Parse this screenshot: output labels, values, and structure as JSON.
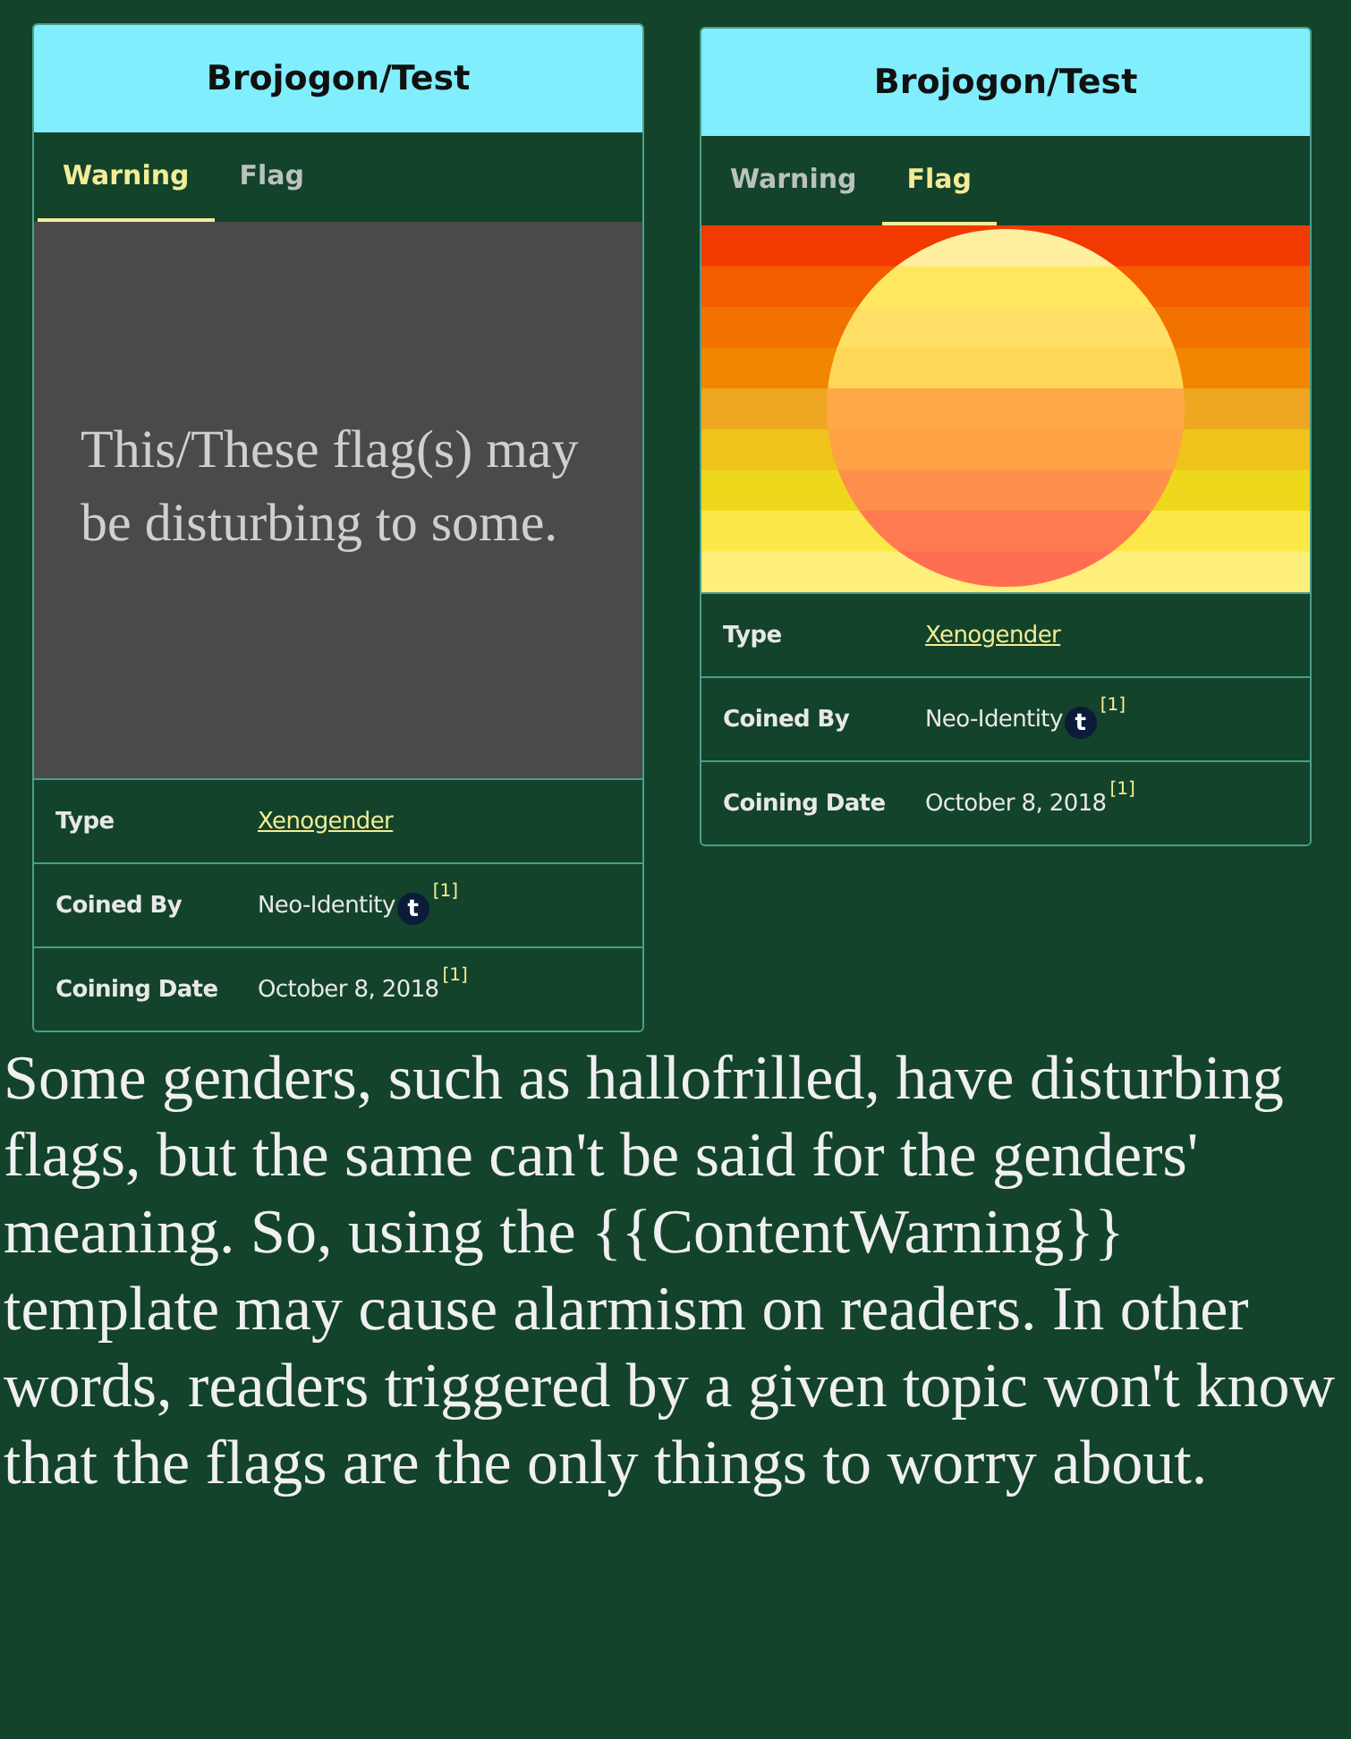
{
  "cards": [
    {
      "title": "Brojogon/Test",
      "tabs": [
        {
          "label": "Warning",
          "selected": true
        },
        {
          "label": "Flag",
          "selected": false
        }
      ],
      "panel": {
        "kind": "warning",
        "text": "This/These flag(s) may be disturbing to some."
      },
      "rows": [
        {
          "label": "Type",
          "value": "Xenogender",
          "kind": "link"
        },
        {
          "label": "Coined By",
          "value": "Neo-Identity",
          "kind": "text",
          "icon_letter": "t",
          "ref": "[1]"
        },
        {
          "label": "Coining Date",
          "value": "October 8, 2018",
          "kind": "text",
          "ref": "[1]"
        }
      ]
    },
    {
      "title": "Brojogon/Test",
      "tabs": [
        {
          "label": "Warning",
          "selected": false
        },
        {
          "label": "Flag",
          "selected": true
        }
      ],
      "panel": {
        "kind": "flag"
      },
      "rows": [
        {
          "label": "Type",
          "value": "Xenogender",
          "kind": "link"
        },
        {
          "label": "Coined By",
          "value": "Neo-Identity",
          "kind": "text",
          "icon_letter": "t",
          "ref": "[1]"
        },
        {
          "label": "Coining Date",
          "value": "October 8, 2018",
          "kind": "text",
          "ref": "[1]"
        }
      ]
    }
  ],
  "paragraph": "Some genders, such as hallofrilled, have disturbing flags, but the same can't be said for the genders' meaning. So, using the {{ContentWarning}} template may cause alarmism on readers. In other words, readers triggered by a given topic won't know that the flags are the only things to worry about."
}
